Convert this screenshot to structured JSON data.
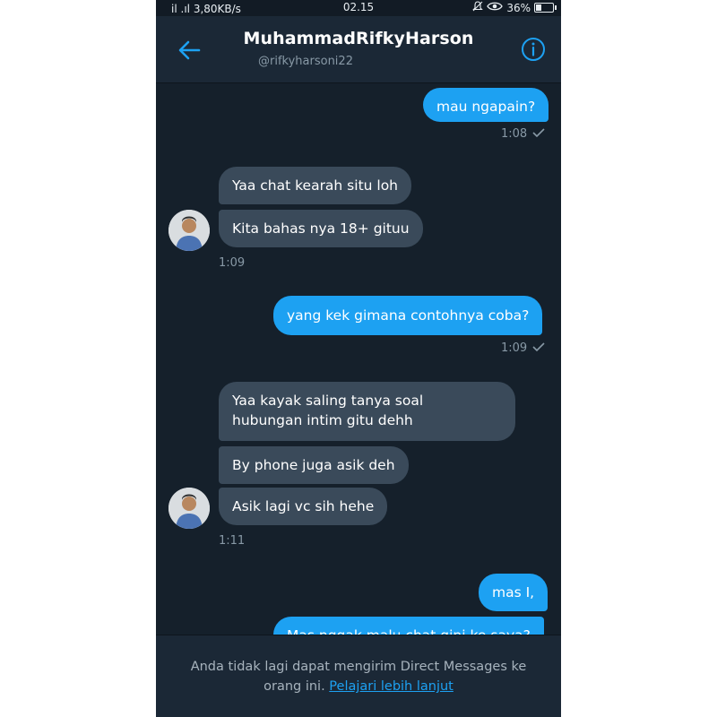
{
  "status_bar": {
    "left": "ﾠil .ıl 3,80KB/s",
    "time": "02.15",
    "battery": "36%",
    "battery_level": 0.36
  },
  "header": {
    "name": "MuhammadRifkyHarson",
    "handle": "@rifkyharsoni22",
    "back_icon": "arrow-left-icon",
    "info_icon": "info-circle-icon"
  },
  "messages": [
    {
      "dir": "sent",
      "text": "mau ngapain?"
    },
    {
      "dir": "meta_sent",
      "text": "1:08"
    },
    {
      "dir": "recv",
      "text": "Yaa chat kearah situ loh"
    },
    {
      "dir": "recv",
      "text": "Kita bahas nya 18+ gituu"
    },
    {
      "dir": "meta_recv",
      "text": "1:09"
    },
    {
      "dir": "sent",
      "text": "yang kek gimana contohnya coba?"
    },
    {
      "dir": "meta_sent",
      "text": "1:09"
    },
    {
      "dir": "recv",
      "text": "Yaa kayak saling tanya soal"
    },
    {
      "dir": "recv_cont",
      "text": "hubungan intim gitu dehh"
    },
    {
      "dir": "recv",
      "text": "By phone juga asik deh"
    },
    {
      "dir": "recv",
      "text": "Asik lagi vc sih hehe"
    },
    {
      "dir": "meta_recv",
      "text": "1:11"
    },
    {
      "dir": "sent",
      "text": "mas I,"
    },
    {
      "dir": "sent",
      "text": "Mas nggak malu chat gini ke saya?"
    }
  ],
  "footer": {
    "text": "Anda tidak lagi dapat mengirim Direct Messages ke orang ini.",
    "link": "Pelajari lebih lanjut"
  },
  "colors": {
    "background": "#15202b",
    "sent_bubble": "#1da1f2",
    "received_bubble": "#3a4a5a",
    "accent": "#1da1f2",
    "muted_text": "#8899a6"
  }
}
